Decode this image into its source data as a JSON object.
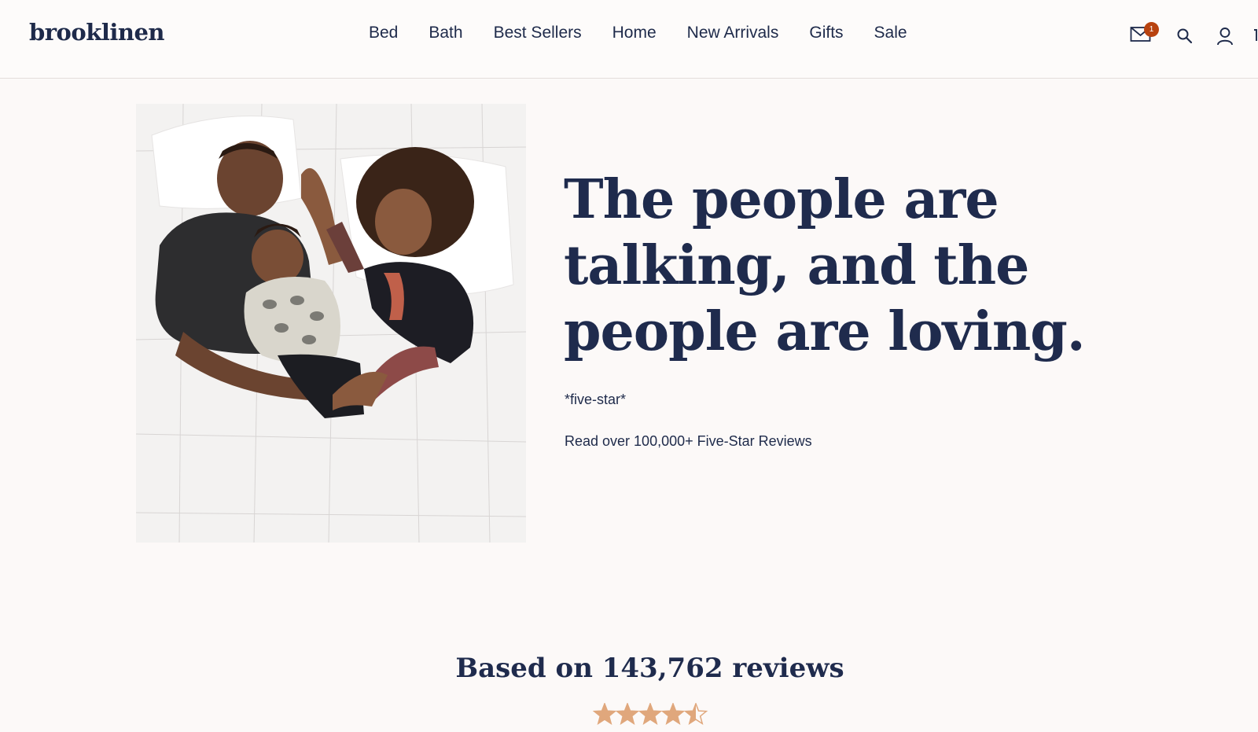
{
  "brand": {
    "logo_text": "brooklinen"
  },
  "nav": {
    "items": [
      "Bed",
      "Bath",
      "Best Sellers",
      "Home",
      "New Arrivals",
      "Gifts",
      "Sale"
    ]
  },
  "header_icons": {
    "mail_icon": "mail-icon",
    "mail_badge_count": "1",
    "search_icon": "search-icon",
    "account_icon": "account-icon",
    "cart_icon": "cart-icon"
  },
  "hero": {
    "image_alt": "family-in-bed-photo",
    "headline": "The people are talking, and the people are loving.",
    "tagline": "*five-star*",
    "reviews_link": "Read over 100,000+ Five-Star Reviews"
  },
  "reviews_summary": {
    "title": "Based on 143,762 reviews",
    "rating": 4.5,
    "max_rating": 5
  },
  "colors": {
    "navy": "#1f2b4d",
    "background": "#fcf9f8",
    "badge": "#b8420f",
    "star": "#e0a77c"
  }
}
